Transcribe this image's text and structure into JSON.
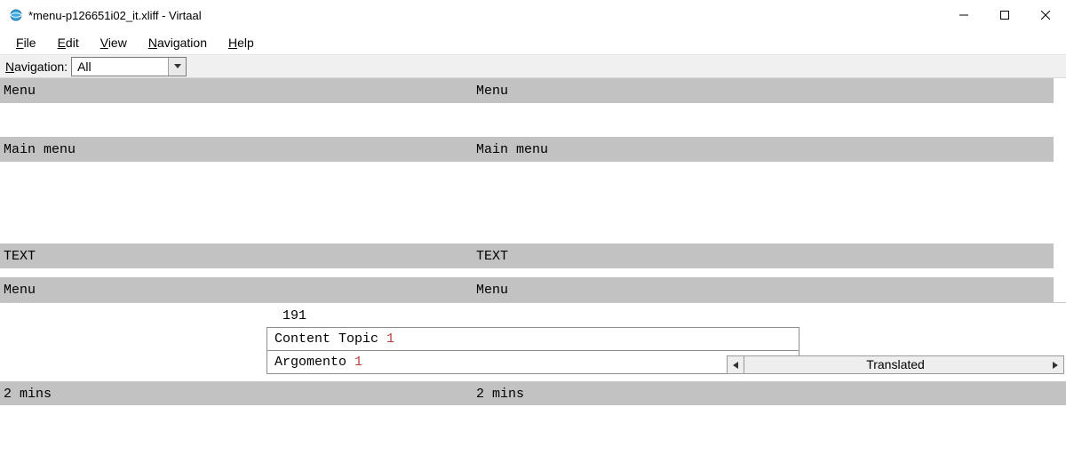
{
  "window": {
    "title": "*menu-p126651i02_it.xliff - Virtaal"
  },
  "menubar": {
    "file": "File",
    "edit": "Edit",
    "view": "View",
    "navigation": "Navigation",
    "help": "Help"
  },
  "nav_toolbar": {
    "label": "Navigation:",
    "selected": "All"
  },
  "segments": [
    {
      "type": "gray",
      "src": "Menu",
      "tgt": "Menu"
    },
    {
      "type": "gap",
      "height": 38
    },
    {
      "type": "gray",
      "src": "Main menu",
      "tgt": "Main menu"
    },
    {
      "type": "gap",
      "height": 92
    },
    {
      "type": "gray",
      "src": "TEXT",
      "tgt": "TEXT"
    },
    {
      "type": "gap",
      "height": 10
    },
    {
      "type": "gray",
      "src": "Menu",
      "tgt": "Menu"
    }
  ],
  "active_unit": {
    "id": "191",
    "source_text": "Content Topic ",
    "source_placeholder": "1",
    "target_text": "Argomento ",
    "target_placeholder": "1",
    "status": "Translated"
  },
  "footer": {
    "src": "2 mins",
    "tgt": "2 mins"
  }
}
